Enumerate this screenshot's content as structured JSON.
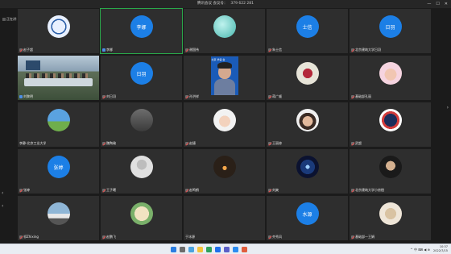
{
  "window": {
    "title": "腾讯会议 会议号：",
    "meeting_id": "379 622 281",
    "controls": [
      "—",
      "☐",
      "✕"
    ]
  },
  "speaker_bar": {
    "text": "正在讲："
  },
  "speaking_chip": {
    "text": "正在讲话：李娜"
  },
  "nav": {
    "left": "‹",
    "right": "›"
  },
  "colors": {
    "accent": "#1c7fe6",
    "active_border": "#2aa84a",
    "muted": "#e84a4a"
  },
  "tiles": [
    {
      "kind": "pic",
      "label": "赵子超",
      "mic": "muted",
      "icon": "school-emblem-avatar"
    },
    {
      "kind": "text",
      "avatar_text": "李娜",
      "label": "李娜",
      "mic": "on",
      "active": true
    },
    {
      "kind": "pic",
      "label": "谢国伟",
      "mic": "muted",
      "icon": "dolphin-avatar"
    },
    {
      "kind": "text",
      "avatar_text": "士信",
      "label": "朱士信",
      "mic": "muted"
    },
    {
      "kind": "text",
      "avatar_text": "日羽",
      "label": "北京建筑大学日羽",
      "mic": "muted"
    },
    {
      "kind": "video-room",
      "label": "刘黎明",
      "mic": "on"
    },
    {
      "kind": "text",
      "avatar_text": "日羽",
      "label": "刘日羽",
      "mic": "muted"
    },
    {
      "kind": "video-speaker",
      "label": "孙洪祥",
      "mic": "muted",
      "screen_text": "北京 学第 会"
    },
    {
      "kind": "pic",
      "label": "蒋广顺",
      "mic": "muted",
      "icon": "berries-avatar"
    },
    {
      "kind": "pic",
      "label": "基础部孔丽",
      "mic": "muted",
      "icon": "child-avatar"
    },
    {
      "kind": "pic",
      "label": "李静-北京工业大学",
      "mic": "none",
      "icon": "sky-avatar"
    },
    {
      "kind": "pic",
      "label": "魏陶瑜",
      "mic": "muted",
      "icon": "person-room-avatar"
    },
    {
      "kind": "pic",
      "label": "赵捷",
      "mic": "muted",
      "icon": "girl-avatar"
    },
    {
      "kind": "pic",
      "label": "王丽修",
      "mic": "muted",
      "icon": "woman-avatar"
    },
    {
      "kind": "pic",
      "label": "武超",
      "mic": "muted",
      "icon": "badge-avatar"
    },
    {
      "kind": "text",
      "avatar_text": "张婷",
      "label": "张婷",
      "mic": "muted"
    },
    {
      "kind": "pic",
      "label": "王子曦",
      "mic": "muted",
      "icon": "default-user-avatar"
    },
    {
      "kind": "pic",
      "label": "赵鸣鹤",
      "mic": "muted",
      "icon": "sunset-avatar"
    },
    {
      "kind": "pic",
      "label": "刘爽",
      "mic": "muted",
      "icon": "galaxy-avatar"
    },
    {
      "kind": "pic",
      "label": "北京建筑大学小房橙",
      "mic": "muted",
      "icon": "portrait-avatar"
    },
    {
      "kind": "pic",
      "label": "祁Zhixing",
      "mic": "muted",
      "icon": "train-avatar"
    },
    {
      "kind": "pic",
      "label": "赵鹏飞",
      "mic": "muted",
      "icon": "illustration-avatar"
    },
    {
      "kind": "pic",
      "label": "于冰源",
      "mic": "none",
      "icon": "blank-avatar"
    },
    {
      "kind": "text",
      "avatar_text": "水源",
      "label": "齐秀风",
      "mic": "muted"
    },
    {
      "kind": "pic",
      "label": "基础部—王娟",
      "mic": "muted",
      "icon": "cat-avatar"
    }
  ],
  "taskbar": {
    "tray_icons": "^ 中 ⌨ ◀ ⊕",
    "time": "10:37",
    "date": "2022/7/15"
  }
}
